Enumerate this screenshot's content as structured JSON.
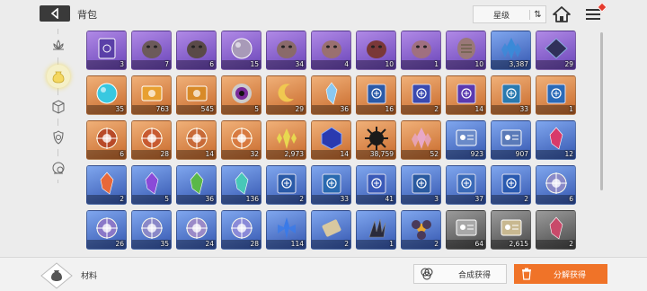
{
  "header": {
    "title": "背包",
    "sort_label": "星级",
    "sort_icon": "⇅"
  },
  "sidebar": {
    "items": [
      {
        "name": "lotus-icon",
        "active": false
      },
      {
        "name": "material-bag-icon",
        "active": true
      },
      {
        "name": "cube-icon",
        "active": false
      },
      {
        "name": "gear-shield-icon",
        "active": false
      },
      {
        "name": "circle-gear-icon",
        "active": false
      }
    ]
  },
  "inventory": {
    "items": [
      {
        "rarity": "purple",
        "qty": "3",
        "icon": "card-icon",
        "color": "#5a3fa8"
      },
      {
        "rarity": "purple",
        "qty": "7",
        "icon": "stone-head-icon",
        "color": "#6c5a5a"
      },
      {
        "rarity": "purple",
        "qty": "6",
        "icon": "stone-head-icon",
        "color": "#5a4a48"
      },
      {
        "rarity": "purple",
        "qty": "15",
        "icon": "orb-icon",
        "color": "#a89ab8"
      },
      {
        "rarity": "purple",
        "qty": "34",
        "icon": "stone-head-icon",
        "color": "#8a6a6a"
      },
      {
        "rarity": "purple",
        "qty": "4",
        "icon": "stone-head-icon",
        "color": "#9a7070"
      },
      {
        "rarity": "purple",
        "qty": "10",
        "icon": "stone-head-icon",
        "color": "#7a3838"
      },
      {
        "rarity": "purple",
        "qty": "1",
        "icon": "stone-head-icon",
        "color": "#a07080"
      },
      {
        "rarity": "purple",
        "qty": "10",
        "icon": "mask-icon",
        "color": "#9a7878"
      },
      {
        "rarity": "blue",
        "qty": "3,387",
        "icon": "crystal-cluster-icon",
        "color": "#3a8ad8"
      },
      {
        "rarity": "purple",
        "qty": "29",
        "icon": "tablet-icon",
        "color": "#30305a"
      },
      {
        "rarity": "orange",
        "qty": "35",
        "icon": "orb-icon",
        "color": "#38c8e0"
      },
      {
        "rarity": "orange",
        "qty": "763",
        "icon": "ticket-icon",
        "color": "#e8a030"
      },
      {
        "rarity": "orange",
        "qty": "545",
        "icon": "ticket-icon",
        "color": "#d88a28"
      },
      {
        "rarity": "orange",
        "qty": "5",
        "icon": "eye-orb-icon",
        "color": "#7a2a9a"
      },
      {
        "rarity": "orange",
        "qty": "29",
        "icon": "crescent-icon",
        "color": "#f0c850"
      },
      {
        "rarity": "orange",
        "qty": "36",
        "icon": "crystal-icon",
        "color": "#8ac8f0"
      },
      {
        "rarity": "orange",
        "qty": "16",
        "icon": "book-icon",
        "color": "#2a5aa8"
      },
      {
        "rarity": "orange",
        "qty": "2",
        "icon": "book-icon",
        "color": "#3a4ab0"
      },
      {
        "rarity": "orange",
        "qty": "14",
        "icon": "book-icon",
        "color": "#5a3ab0"
      },
      {
        "rarity": "orange",
        "qty": "33",
        "icon": "book-icon",
        "color": "#2a7ab0"
      },
      {
        "rarity": "orange",
        "qty": "1",
        "icon": "book-icon",
        "color": "#2a6ab8"
      },
      {
        "rarity": "orange",
        "qty": "6",
        "icon": "compass-icon",
        "color": "#b84a28"
      },
      {
        "rarity": "orange",
        "qty": "28",
        "icon": "compass-icon",
        "color": "#c85a30"
      },
      {
        "rarity": "orange",
        "qty": "14",
        "icon": "compass-icon",
        "color": "#c86a38"
      },
      {
        "rarity": "orange",
        "qty": "32",
        "icon": "compass-icon",
        "color": "#d87a40"
      },
      {
        "rarity": "orange",
        "qty": "2,973",
        "icon": "spark-crystal-icon",
        "color": "#e8d850"
      },
      {
        "rarity": "orange",
        "qty": "14",
        "icon": "cube-crystal-icon",
        "color": "#2a3ab0"
      },
      {
        "rarity": "orange",
        "qty": "38,759",
        "icon": "dark-spike-icon",
        "color": "#1a1a1a"
      },
      {
        "rarity": "orange",
        "qty": "52",
        "icon": "crystal-cluster-icon",
        "color": "#e8a8c8"
      },
      {
        "rarity": "blue",
        "qty": "923",
        "icon": "id-card-icon",
        "color": "#6a8ac8"
      },
      {
        "rarity": "blue",
        "qty": "907",
        "icon": "id-card-icon",
        "color": "#5a7ab8"
      },
      {
        "rarity": "blue",
        "qty": "12",
        "icon": "shard-icon",
        "color": "#d83a6a"
      },
      {
        "rarity": "blue",
        "qty": "2",
        "icon": "shard-icon",
        "color": "#e8683a"
      },
      {
        "rarity": "blue",
        "qty": "5",
        "icon": "shard-icon",
        "color": "#8a4ad8"
      },
      {
        "rarity": "blue",
        "qty": "36",
        "icon": "shard-icon",
        "color": "#5ab848"
      },
      {
        "rarity": "blue",
        "qty": "136",
        "icon": "shard-icon",
        "color": "#48c8b8"
      },
      {
        "rarity": "blue",
        "qty": "2",
        "icon": "book-icon",
        "color": "#2a5aa8"
      },
      {
        "rarity": "blue",
        "qty": "33",
        "icon": "book-icon",
        "color": "#2a6ab0"
      },
      {
        "rarity": "blue",
        "qty": "41",
        "icon": "book-icon",
        "color": "#3a5ab8"
      },
      {
        "rarity": "blue",
        "qty": "3",
        "icon": "book-icon",
        "color": "#2a5aa0"
      },
      {
        "rarity": "blue",
        "qty": "37",
        "icon": "book-icon",
        "color": "#3a6ab8"
      },
      {
        "rarity": "blue",
        "qty": "2",
        "icon": "book-icon",
        "color": "#2a5ab0"
      },
      {
        "rarity": "blue",
        "qty": "6",
        "icon": "compass-icon",
        "color": "#8a8ac8"
      },
      {
        "rarity": "blue",
        "qty": "26",
        "icon": "compass-icon",
        "color": "#8a78c8"
      },
      {
        "rarity": "blue",
        "qty": "35",
        "icon": "compass-icon",
        "color": "#8a88c8"
      },
      {
        "rarity": "blue",
        "qty": "24",
        "icon": "compass-icon",
        "color": "#9a8ac8"
      },
      {
        "rarity": "blue",
        "qty": "28",
        "icon": "compass-icon",
        "color": "#8a8ad8"
      },
      {
        "rarity": "blue",
        "qty": "114",
        "icon": "flower-crystal-icon",
        "color": "#3a7ae8"
      },
      {
        "rarity": "blue",
        "qty": "2",
        "icon": "scroll-icon",
        "color": "#d8c8a0"
      },
      {
        "rarity": "blue",
        "qty": "1",
        "icon": "dark-claw-icon",
        "color": "#2a2a3a"
      },
      {
        "rarity": "blue",
        "qty": "2",
        "icon": "dark-flower-icon",
        "color": "#4a3a5a"
      },
      {
        "rarity": "gray",
        "qty": "64",
        "icon": "id-card-icon",
        "color": "#a8a8a8"
      },
      {
        "rarity": "gray",
        "qty": "2,615",
        "icon": "id-card-icon",
        "color": "#c8b890"
      },
      {
        "rarity": "gray",
        "qty": "2",
        "icon": "shard-icon",
        "color": "#c84a6a"
      }
    ]
  },
  "footer": {
    "category_label": "材料",
    "synthesize_label": "合成获得",
    "decompose_label": "分解获得"
  },
  "colors": {
    "accent": "#f07328",
    "active_tab_glow": "#f0dc6a"
  }
}
